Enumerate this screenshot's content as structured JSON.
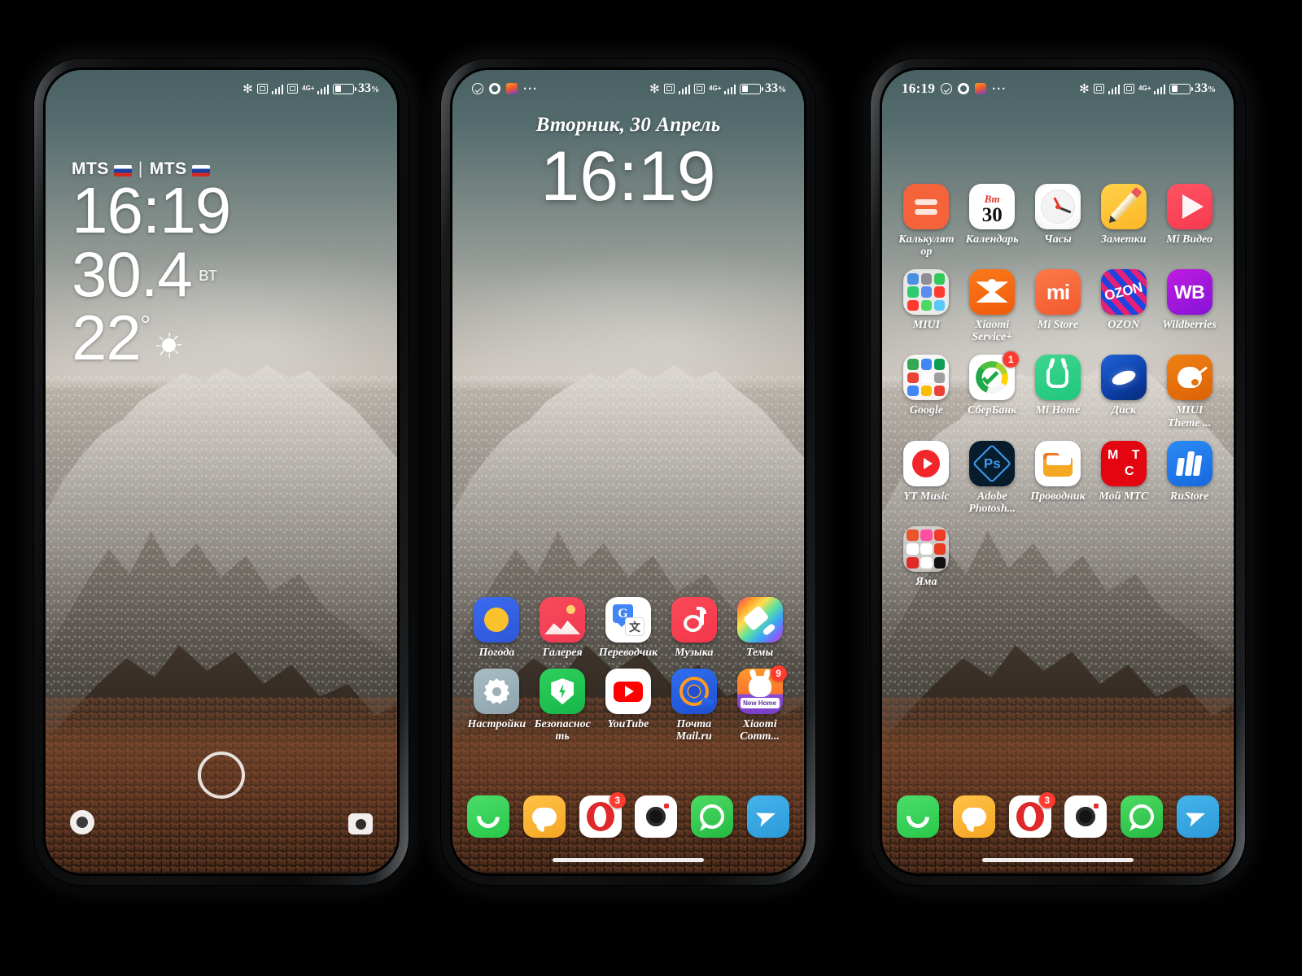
{
  "status_bar": {
    "time": "16:19",
    "battery_pct": "33",
    "battery_unit": "%",
    "network": "4G+",
    "icons": [
      "check-circle-icon",
      "opera-icon",
      "app-notification-icon",
      "more-dots-icon",
      "bluetooth-icon",
      "sim1-icon",
      "signal-bars-icon",
      "sim2-icon",
      "signal-bars-icon",
      "battery-icon"
    ]
  },
  "phone1": {
    "carrier_left": "MTS",
    "carrier_sep": "|",
    "carrier_right": "MTS",
    "time": "16:19",
    "date_number": "30.4",
    "weekday_short": "вт",
    "temperature": "22",
    "degree": "°",
    "weather_icon": "sun-icon",
    "shortcut_left": "flashlight-icon",
    "shortcut_right": "camera-icon",
    "fingerprint": "fingerprint-ring-icon"
  },
  "phone2": {
    "date": "Вторник, 30 Апрель",
    "clock": "16:19",
    "apps": [
      {
        "label": "Погода",
        "icon": "weather-icon",
        "cls": "i-weather"
      },
      {
        "label": "Галерея",
        "icon": "gallery-icon",
        "cls": "i-gallery"
      },
      {
        "label": "Переводчик",
        "icon": "translate-icon",
        "cls": "i-translate"
      },
      {
        "label": "Музыка",
        "icon": "music-icon",
        "cls": "i-music"
      },
      {
        "label": "Темы",
        "icon": "themes-icon",
        "cls": "i-themes"
      },
      {
        "label": "Настройки",
        "icon": "settings-gear-icon",
        "cls": "i-settings"
      },
      {
        "label": "Безопасность",
        "icon": "security-shield-icon",
        "cls": "i-security"
      },
      {
        "label": "YouTube",
        "icon": "youtube-icon",
        "cls": "i-youtube"
      },
      {
        "label": "Почта Mail.ru",
        "icon": "mailru-icon",
        "cls": "i-mailru"
      },
      {
        "label": "Xiaomi Comm...",
        "icon": "xiaomi-community-icon",
        "cls": "i-xcomm",
        "badge": "9",
        "sub_label": "New Home"
      }
    ]
  },
  "phone3": {
    "apps": [
      {
        "label": "Калькулятор",
        "icon": "calculator-icon",
        "cls": "i-calc"
      },
      {
        "label": "Календарь",
        "icon": "calendar-icon",
        "cls": "i-cal",
        "cal_weekday": "Вт",
        "cal_day": "30"
      },
      {
        "label": "Часы",
        "icon": "clock-icon",
        "cls": "i-clock"
      },
      {
        "label": "Заметки",
        "icon": "notes-pencil-icon",
        "cls": "i-notes"
      },
      {
        "label": "Mi Видео",
        "icon": "mi-video-icon",
        "cls": "i-mivideo"
      },
      {
        "label": "MIUI",
        "icon": "miui-folder-icon",
        "cls": "i-folder i-miui",
        "folder": [
          "#4a90e2",
          "#8e8e93",
          "#34c759",
          "#2ecc71",
          "#5b8def",
          "#ff3b30",
          "#ff3b30",
          "#4cd964",
          "#5ac8fa"
        ]
      },
      {
        "label": "Xiaomi Service+",
        "icon": "xiaomi-service-icon",
        "cls": "i-xservice"
      },
      {
        "label": "Mi Store",
        "icon": "mi-store-icon",
        "cls": "i-mistore",
        "mi_text": "mi"
      },
      {
        "label": "OZON",
        "icon": "ozon-icon",
        "cls": "i-ozon",
        "ozon_text": "OZON"
      },
      {
        "label": "Wildberries",
        "icon": "wildberries-icon",
        "cls": "i-wb",
        "wb_text": "WB"
      },
      {
        "label": "Google",
        "icon": "google-folder-icon",
        "cls": "i-folder i-google",
        "folder": [
          "#34a853",
          "#4285f4",
          "#0f9d58",
          "#ea4335",
          "#ffffff",
          "#9e9e9e",
          "#4285f4",
          "#fbbc05",
          "#ea4335"
        ]
      },
      {
        "label": "СберБанк",
        "icon": "sberbank-icon",
        "cls": "i-sber",
        "badge": "1"
      },
      {
        "label": "Mi Home",
        "icon": "mi-home-icon",
        "cls": "i-mihome"
      },
      {
        "label": "Диск",
        "icon": "yandex-disk-icon",
        "cls": "i-disk"
      },
      {
        "label": "MIUI Theme ...",
        "icon": "miui-theme-icon",
        "cls": "i-theme"
      },
      {
        "label": "YT Music",
        "icon": "youtube-music-icon",
        "cls": "i-ytm"
      },
      {
        "label": "Adobe Photosh...",
        "icon": "photoshop-icon",
        "cls": "i-ps",
        "ps_text": "Ps"
      },
      {
        "label": "Проводник",
        "icon": "file-manager-icon",
        "cls": "i-files"
      },
      {
        "label": "Мой МТС",
        "icon": "mts-icon",
        "cls": "i-mts",
        "mts_r1": "М Т",
        "mts_r2": "С"
      },
      {
        "label": "RuStore",
        "icon": "rustore-icon",
        "cls": "i-rustore"
      },
      {
        "label": "Яма",
        "icon": "yama-folder-icon",
        "cls": "i-folder i-yama",
        "folder": [
          "#e8542b",
          "#ff4fa3",
          "#f03b28",
          "#ffffff",
          "#ffffff",
          "#e83b1f",
          "#e02b2b",
          "#ffffff",
          "#111111"
        ]
      }
    ]
  },
  "dock": [
    {
      "label": "Телефон",
      "icon": "phone-icon",
      "cls": "i-phone"
    },
    {
      "label": "СМС",
      "icon": "sms-icon",
      "cls": "i-sms"
    },
    {
      "label": "Opera",
      "icon": "opera-icon",
      "cls": "i-opera2",
      "badge": "3"
    },
    {
      "label": "Камера",
      "icon": "camera-icon",
      "cls": "i-camera"
    },
    {
      "label": "WhatsApp",
      "icon": "whatsapp-icon",
      "cls": "i-whatsapp"
    },
    {
      "label": "Telegram",
      "icon": "telegram-icon",
      "cls": "i-telegram"
    }
  ],
  "colors": {
    "accent_red": "#ff3b30",
    "sky_top": "#4a6164",
    "sky_bottom": "#c8c0b6",
    "page_bg": "#000000"
  }
}
